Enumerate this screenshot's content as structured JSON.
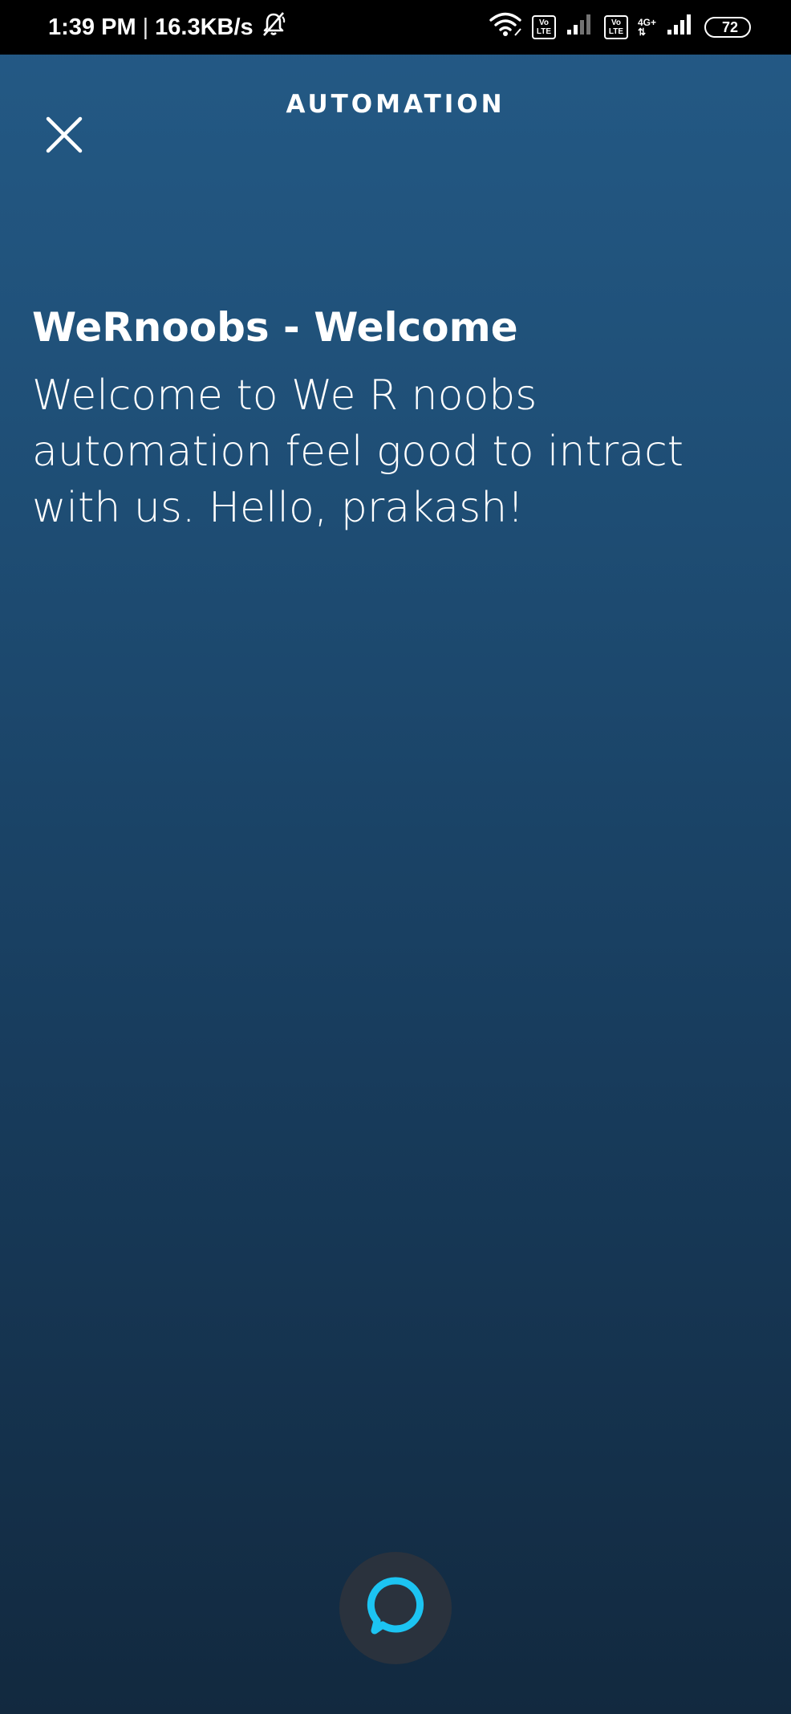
{
  "status_bar": {
    "time": "1:39 PM",
    "separator": "|",
    "network_speed": "16.3KB/s",
    "sim1_badge_top": "Vo",
    "sim1_badge_bottom": "LTE",
    "sim2_badge_top": "Vo",
    "sim2_badge_bottom": "LTE",
    "network_type": "4G+",
    "network_arrows": "⇅",
    "battery_level": "72",
    "icons": [
      "mute-bell-icon",
      "wifi-icon",
      "signal-icon",
      "signal-icon",
      "battery-icon"
    ]
  },
  "header": {
    "title": "AUTOMATION",
    "close_icon": "close-icon"
  },
  "card": {
    "title": "WeRnoobs - Welcome",
    "body": "Welcome to We R noobs automation feel good to intract with us. Hello, prakash!"
  },
  "alexa": {
    "icon": "alexa-ring-icon",
    "ring_color": "#1cc4f2"
  },
  "colors": {
    "background_top": "#245a86",
    "background_bottom": "#12293f",
    "status_bar": "#000000",
    "alexa_button_bg": "#2a323d"
  }
}
